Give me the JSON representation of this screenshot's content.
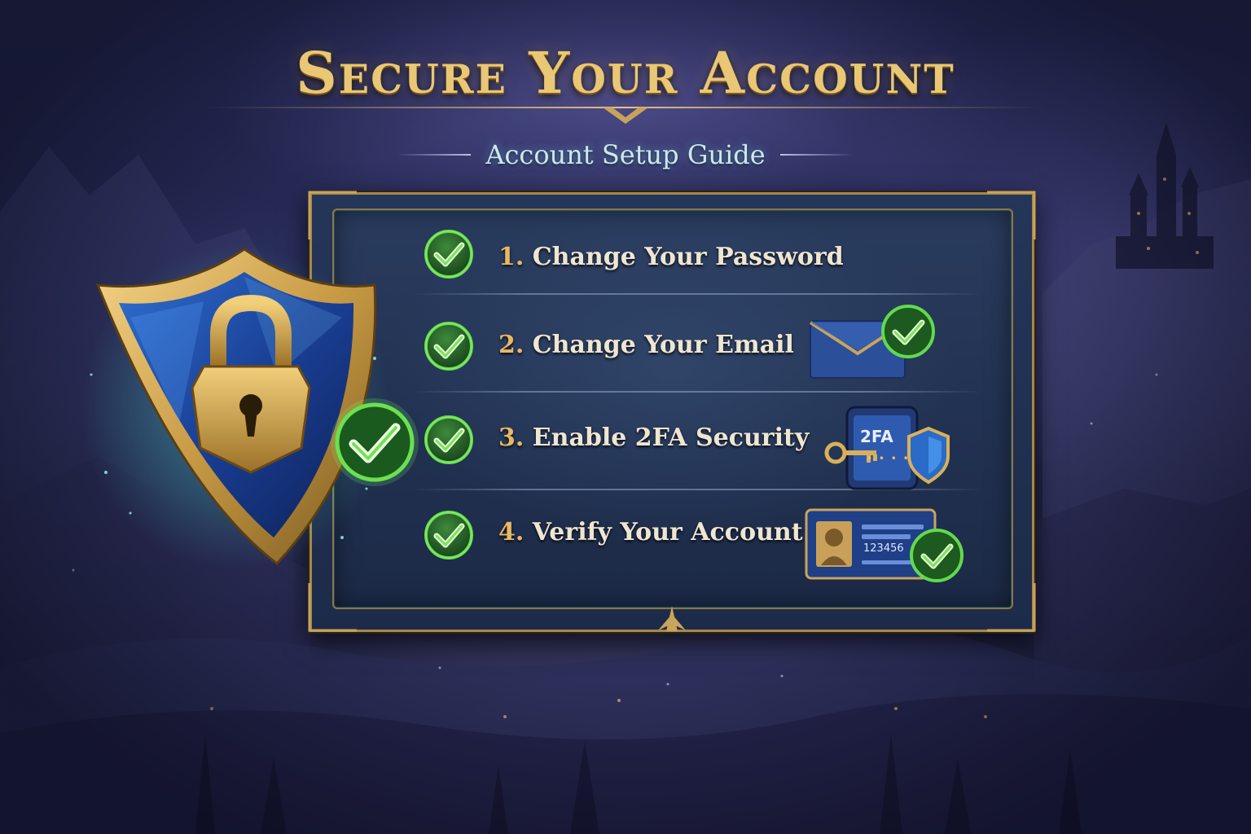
{
  "header": {
    "title": "Secure Your Account",
    "subtitle": "Account Setup Guide"
  },
  "steps": [
    {
      "number": "1.",
      "label": "Change Your Password",
      "completed": true,
      "illustration": "none"
    },
    {
      "number": "2.",
      "label": "Change Your Email",
      "completed": true,
      "illustration": "envelope-check-icon"
    },
    {
      "number": "3.",
      "label": "Enable 2FA Security",
      "completed": true,
      "illustration": "phone-2fa-icon"
    },
    {
      "number": "4.",
      "label": "Verify Your Account",
      "completed": true,
      "illustration": "id-card-check-icon"
    }
  ],
  "illustrations": {
    "phone_text": "2FA",
    "phone_dots": "• • • •",
    "id_card_number": "123456"
  },
  "hero": {
    "icon": "shield-lock-icon",
    "status_icon": "check-icon"
  },
  "colors": {
    "gold": "#e9c774",
    "panel_bg": "#223252",
    "check_green": "#3fbf3a",
    "subtitle_glow": "#cfe6ee"
  }
}
